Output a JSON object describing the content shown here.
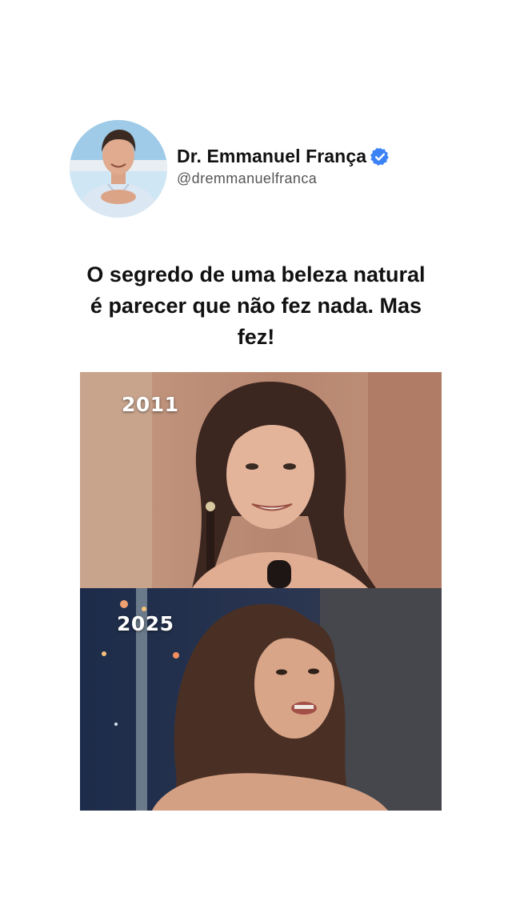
{
  "profile": {
    "display_name": "Dr. Emmanuel França",
    "handle": "@dremmanuelfranca",
    "verified": true,
    "verified_color": "#3b82f6"
  },
  "post": {
    "headline": "O segredo de uma beleza natural é parecer que não fez nada. Mas fez!"
  },
  "media": {
    "top_frame": {
      "year_label": "2011"
    },
    "bottom_frame": {
      "year_label": "2025"
    }
  }
}
